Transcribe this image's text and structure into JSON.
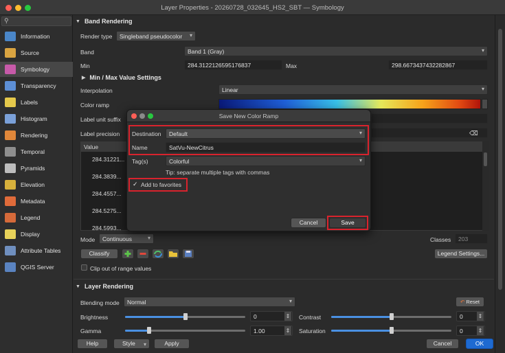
{
  "window": {
    "title": "Layer Properties - 20260728_032645_HS2_SBT — Symbology"
  },
  "sidebar": {
    "items": [
      {
        "label": "Information",
        "icon": "info-icon",
        "color": "#4a86c8"
      },
      {
        "label": "Source",
        "icon": "source-icon",
        "color": "#d9a441"
      },
      {
        "label": "Symbology",
        "icon": "symbology-icon",
        "color": "#c75aa9",
        "active": true
      },
      {
        "label": "Transparency",
        "icon": "transparency-icon",
        "color": "#5d8fd6"
      },
      {
        "label": "Labels",
        "icon": "labels-icon",
        "color": "#e4c84b"
      },
      {
        "label": "Histogram",
        "icon": "histogram-icon",
        "color": "#7aa0d8"
      },
      {
        "label": "Rendering",
        "icon": "rendering-icon",
        "color": "#e0873a"
      },
      {
        "label": "Temporal",
        "icon": "temporal-icon",
        "color": "#8e8e8e"
      },
      {
        "label": "Pyramids",
        "icon": "pyramids-icon",
        "color": "#bdbdbd"
      },
      {
        "label": "Elevation",
        "icon": "elevation-icon",
        "color": "#d7b13c"
      },
      {
        "label": "Metadata",
        "icon": "metadata-icon",
        "color": "#e06b3a"
      },
      {
        "label": "Legend",
        "icon": "legend-icon",
        "color": "#d66a3a"
      },
      {
        "label": "Display",
        "icon": "display-icon",
        "color": "#e8d25a"
      },
      {
        "label": "Attribute Tables",
        "icon": "attribute-tables-icon",
        "color": "#6f8fbf"
      },
      {
        "label": "QGIS Server",
        "icon": "qgis-server-icon",
        "color": "#5a83c0"
      }
    ]
  },
  "band_rendering": {
    "heading": "Band Rendering",
    "render_type_label": "Render type",
    "render_type_value": "Singleband pseudocolor",
    "band_label": "Band",
    "band_value": "Band 1 (Gray)",
    "min_label": "Min",
    "min_value": "284.3122126595176837",
    "max_label": "Max",
    "max_value": "298.6673437432282867",
    "minmax_heading": "Min / Max Value Settings",
    "interpolation_label": "Interpolation",
    "interpolation_value": "Linear",
    "color_ramp_label": "Color ramp",
    "unit_suffix_label": "Label unit suffix",
    "precision_label": "Label precision",
    "table_header": "Value",
    "table_values": [
      "284.31221...",
      "284.3839...",
      "284.4557...",
      "284.5275...",
      "284.5993..."
    ],
    "mode_label": "Mode",
    "mode_value": "Continuous",
    "classes_label": "Classes",
    "classes_value": "203",
    "classify_label": "Classify",
    "legend_settings_label": "Legend Settings...",
    "clip_label": "Clip out of range values"
  },
  "layer_rendering": {
    "heading": "Layer Rendering",
    "blending_label": "Blending mode",
    "blending_value": "Normal",
    "reset_label": "Reset",
    "brightness_label": "Brightness",
    "brightness_value": "0",
    "brightness_level": 0.5,
    "contrast_label": "Contrast",
    "contrast_value": "0",
    "contrast_level": 0.5,
    "gamma_label": "Gamma",
    "gamma_value": "1.00",
    "gamma_level": 0.2,
    "saturation_label": "Saturation",
    "saturation_value": "0",
    "saturation_level": 0.5
  },
  "footer": {
    "help": "Help",
    "style": "Style",
    "apply": "Apply",
    "cancel": "Cancel",
    "ok": "OK"
  },
  "dialog": {
    "title": "Save New Color Ramp",
    "destination_label": "Destination",
    "destination_value": "Default",
    "name_label": "Name",
    "name_value": "SatVu-NewCitrus",
    "tags_label": "Tag(s)",
    "tags_value": "Colorful",
    "tip": "Tip: separate multiple tags with commas",
    "favorites_label": "Add to favorites",
    "cancel": "Cancel",
    "save": "Save"
  },
  "colors": {
    "accent": "#1e6ad1",
    "highlight": "#d9232d"
  }
}
